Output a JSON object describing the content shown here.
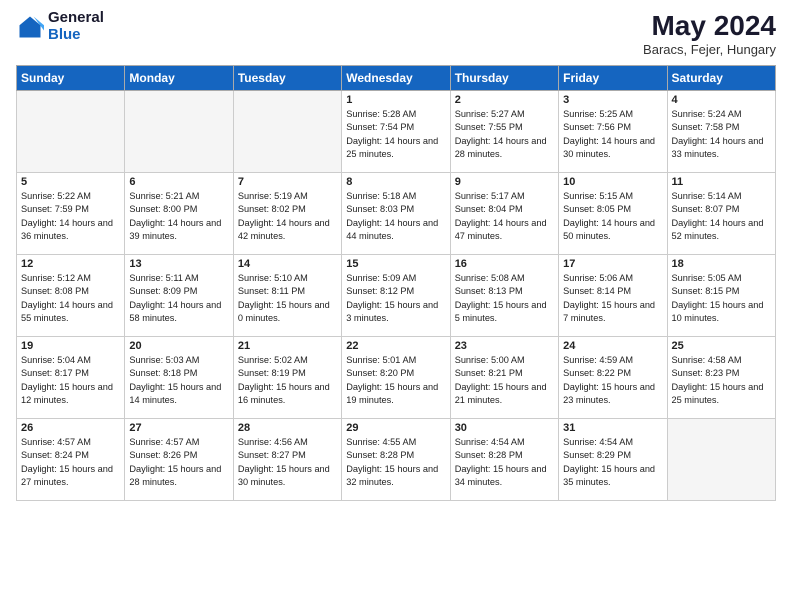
{
  "logo": {
    "general": "General",
    "blue": "Blue"
  },
  "title": {
    "month": "May 2024",
    "location": "Baracs, Fejer, Hungary"
  },
  "headers": [
    "Sunday",
    "Monday",
    "Tuesday",
    "Wednesday",
    "Thursday",
    "Friday",
    "Saturday"
  ],
  "weeks": [
    [
      {
        "day": "",
        "sunrise": "",
        "sunset": "",
        "daylight": "",
        "empty": true
      },
      {
        "day": "",
        "sunrise": "",
        "sunset": "",
        "daylight": "",
        "empty": true
      },
      {
        "day": "",
        "sunrise": "",
        "sunset": "",
        "daylight": "",
        "empty": true
      },
      {
        "day": "1",
        "sunrise": "Sunrise: 5:28 AM",
        "sunset": "Sunset: 7:54 PM",
        "daylight": "Daylight: 14 hours and 25 minutes.",
        "empty": false
      },
      {
        "day": "2",
        "sunrise": "Sunrise: 5:27 AM",
        "sunset": "Sunset: 7:55 PM",
        "daylight": "Daylight: 14 hours and 28 minutes.",
        "empty": false
      },
      {
        "day": "3",
        "sunrise": "Sunrise: 5:25 AM",
        "sunset": "Sunset: 7:56 PM",
        "daylight": "Daylight: 14 hours and 30 minutes.",
        "empty": false
      },
      {
        "day": "4",
        "sunrise": "Sunrise: 5:24 AM",
        "sunset": "Sunset: 7:58 PM",
        "daylight": "Daylight: 14 hours and 33 minutes.",
        "empty": false
      }
    ],
    [
      {
        "day": "5",
        "sunrise": "Sunrise: 5:22 AM",
        "sunset": "Sunset: 7:59 PM",
        "daylight": "Daylight: 14 hours and 36 minutes.",
        "empty": false
      },
      {
        "day": "6",
        "sunrise": "Sunrise: 5:21 AM",
        "sunset": "Sunset: 8:00 PM",
        "daylight": "Daylight: 14 hours and 39 minutes.",
        "empty": false
      },
      {
        "day": "7",
        "sunrise": "Sunrise: 5:19 AM",
        "sunset": "Sunset: 8:02 PM",
        "daylight": "Daylight: 14 hours and 42 minutes.",
        "empty": false
      },
      {
        "day": "8",
        "sunrise": "Sunrise: 5:18 AM",
        "sunset": "Sunset: 8:03 PM",
        "daylight": "Daylight: 14 hours and 44 minutes.",
        "empty": false
      },
      {
        "day": "9",
        "sunrise": "Sunrise: 5:17 AM",
        "sunset": "Sunset: 8:04 PM",
        "daylight": "Daylight: 14 hours and 47 minutes.",
        "empty": false
      },
      {
        "day": "10",
        "sunrise": "Sunrise: 5:15 AM",
        "sunset": "Sunset: 8:05 PM",
        "daylight": "Daylight: 14 hours and 50 minutes.",
        "empty": false
      },
      {
        "day": "11",
        "sunrise": "Sunrise: 5:14 AM",
        "sunset": "Sunset: 8:07 PM",
        "daylight": "Daylight: 14 hours and 52 minutes.",
        "empty": false
      }
    ],
    [
      {
        "day": "12",
        "sunrise": "Sunrise: 5:12 AM",
        "sunset": "Sunset: 8:08 PM",
        "daylight": "Daylight: 14 hours and 55 minutes.",
        "empty": false
      },
      {
        "day": "13",
        "sunrise": "Sunrise: 5:11 AM",
        "sunset": "Sunset: 8:09 PM",
        "daylight": "Daylight: 14 hours and 58 minutes.",
        "empty": false
      },
      {
        "day": "14",
        "sunrise": "Sunrise: 5:10 AM",
        "sunset": "Sunset: 8:11 PM",
        "daylight": "Daylight: 15 hours and 0 minutes.",
        "empty": false
      },
      {
        "day": "15",
        "sunrise": "Sunrise: 5:09 AM",
        "sunset": "Sunset: 8:12 PM",
        "daylight": "Daylight: 15 hours and 3 minutes.",
        "empty": false
      },
      {
        "day": "16",
        "sunrise": "Sunrise: 5:08 AM",
        "sunset": "Sunset: 8:13 PM",
        "daylight": "Daylight: 15 hours and 5 minutes.",
        "empty": false
      },
      {
        "day": "17",
        "sunrise": "Sunrise: 5:06 AM",
        "sunset": "Sunset: 8:14 PM",
        "daylight": "Daylight: 15 hours and 7 minutes.",
        "empty": false
      },
      {
        "day": "18",
        "sunrise": "Sunrise: 5:05 AM",
        "sunset": "Sunset: 8:15 PM",
        "daylight": "Daylight: 15 hours and 10 minutes.",
        "empty": false
      }
    ],
    [
      {
        "day": "19",
        "sunrise": "Sunrise: 5:04 AM",
        "sunset": "Sunset: 8:17 PM",
        "daylight": "Daylight: 15 hours and 12 minutes.",
        "empty": false
      },
      {
        "day": "20",
        "sunrise": "Sunrise: 5:03 AM",
        "sunset": "Sunset: 8:18 PM",
        "daylight": "Daylight: 15 hours and 14 minutes.",
        "empty": false
      },
      {
        "day": "21",
        "sunrise": "Sunrise: 5:02 AM",
        "sunset": "Sunset: 8:19 PM",
        "daylight": "Daylight: 15 hours and 16 minutes.",
        "empty": false
      },
      {
        "day": "22",
        "sunrise": "Sunrise: 5:01 AM",
        "sunset": "Sunset: 8:20 PM",
        "daylight": "Daylight: 15 hours and 19 minutes.",
        "empty": false
      },
      {
        "day": "23",
        "sunrise": "Sunrise: 5:00 AM",
        "sunset": "Sunset: 8:21 PM",
        "daylight": "Daylight: 15 hours and 21 minutes.",
        "empty": false
      },
      {
        "day": "24",
        "sunrise": "Sunrise: 4:59 AM",
        "sunset": "Sunset: 8:22 PM",
        "daylight": "Daylight: 15 hours and 23 minutes.",
        "empty": false
      },
      {
        "day": "25",
        "sunrise": "Sunrise: 4:58 AM",
        "sunset": "Sunset: 8:23 PM",
        "daylight": "Daylight: 15 hours and 25 minutes.",
        "empty": false
      }
    ],
    [
      {
        "day": "26",
        "sunrise": "Sunrise: 4:57 AM",
        "sunset": "Sunset: 8:24 PM",
        "daylight": "Daylight: 15 hours and 27 minutes.",
        "empty": false
      },
      {
        "day": "27",
        "sunrise": "Sunrise: 4:57 AM",
        "sunset": "Sunset: 8:26 PM",
        "daylight": "Daylight: 15 hours and 28 minutes.",
        "empty": false
      },
      {
        "day": "28",
        "sunrise": "Sunrise: 4:56 AM",
        "sunset": "Sunset: 8:27 PM",
        "daylight": "Daylight: 15 hours and 30 minutes.",
        "empty": false
      },
      {
        "day": "29",
        "sunrise": "Sunrise: 4:55 AM",
        "sunset": "Sunset: 8:28 PM",
        "daylight": "Daylight: 15 hours and 32 minutes.",
        "empty": false
      },
      {
        "day": "30",
        "sunrise": "Sunrise: 4:54 AM",
        "sunset": "Sunset: 8:28 PM",
        "daylight": "Daylight: 15 hours and 34 minutes.",
        "empty": false
      },
      {
        "day": "31",
        "sunrise": "Sunrise: 4:54 AM",
        "sunset": "Sunset: 8:29 PM",
        "daylight": "Daylight: 15 hours and 35 minutes.",
        "empty": false
      },
      {
        "day": "",
        "sunrise": "",
        "sunset": "",
        "daylight": "",
        "empty": true
      }
    ]
  ]
}
